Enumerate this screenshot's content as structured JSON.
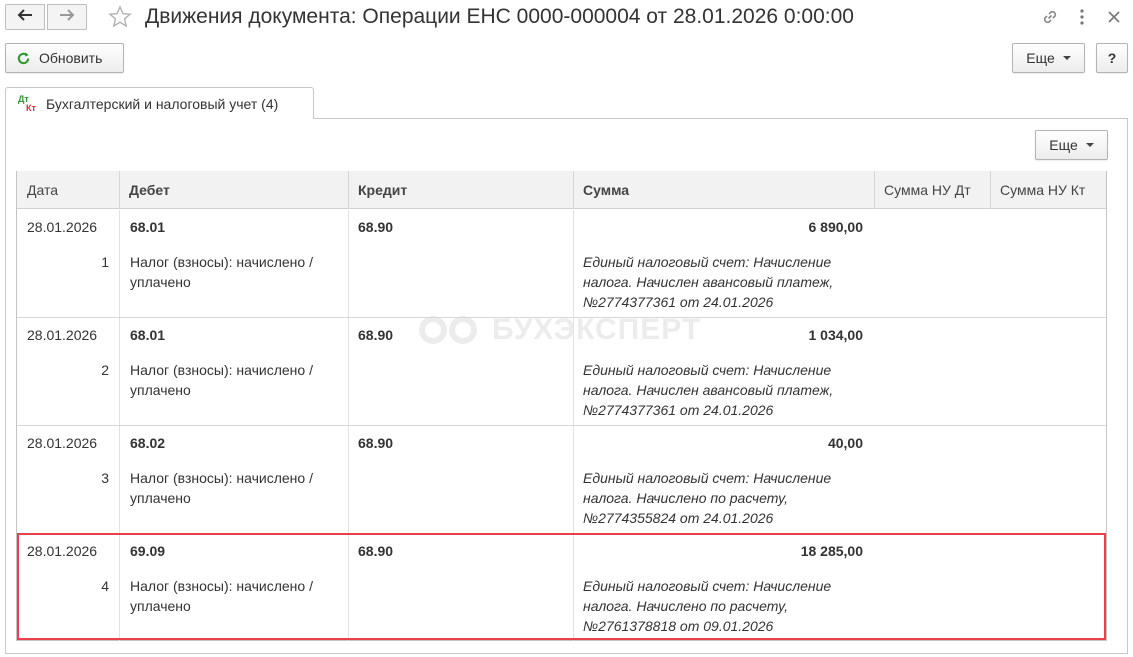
{
  "window": {
    "title": "Движения документа: Операции ЕНС 0000-000004 от 28.01.2026 0:00:00",
    "icons": [
      "back-arrow-icon",
      "forward-arrow-icon",
      "star-icon",
      "link-icon",
      "more-vert-icon",
      "close-icon"
    ]
  },
  "toolbar": {
    "refresh_label": "Обновить",
    "more_label": "Еще",
    "help_label": "?"
  },
  "tab": {
    "label": "Бухгалтерский и налоговый учет (4)",
    "icon_top": "Дт",
    "icon_bottom": "Кт"
  },
  "grid_toolbar": {
    "more_label": "Еще"
  },
  "table": {
    "columns": [
      "Дата",
      "Дебет",
      "Кредит",
      "Сумма",
      "Сумма НУ Дт",
      "Сумма НУ Кт"
    ],
    "rows": [
      {
        "date": "28.01.2026",
        "num": "1",
        "debit": "68.01",
        "debit_note": [
          "Налог (взносы): начислено /",
          "уплачено"
        ],
        "credit": "68.90",
        "sum": "6 890,00",
        "content": [
          "Единый налоговый счет: Начисление",
          "налога. Начислен авансовый платеж,",
          "№2774377361 от 24.01.2026"
        ]
      },
      {
        "date": "28.01.2026",
        "num": "2",
        "debit": "68.01",
        "debit_note": [
          "Налог (взносы): начислено /",
          "уплачено"
        ],
        "credit": "68.90",
        "sum": "1 034,00",
        "content": [
          "Единый налоговый счет: Начисление",
          "налога. Начислен авансовый платеж,",
          "№2774377361 от 24.01.2026"
        ]
      },
      {
        "date": "28.01.2026",
        "num": "3",
        "debit": "68.02",
        "debit_note": [
          "Налог (взносы): начислено /",
          "уплачено"
        ],
        "credit": "68.90",
        "sum": "40,00",
        "content": [
          "Единый налоговый счет: Начисление",
          "налога. Начислено по расчету,",
          "№2774355824 от 24.01.2026"
        ]
      },
      {
        "date": "28.01.2026",
        "num": "4",
        "debit": "69.09",
        "debit_note": [
          "Налог (взносы): начислено /",
          "уплачено"
        ],
        "credit": "68.90",
        "sum": "18 285,00",
        "content": [
          "Единый налоговый счет: Начисление",
          "налога. Начислено по расчету,",
          "№2761378818 от 09.01.2026"
        ]
      }
    ]
  },
  "highlight_color": "#e8414b",
  "watermark": "БУХЭКСПЕРТ"
}
